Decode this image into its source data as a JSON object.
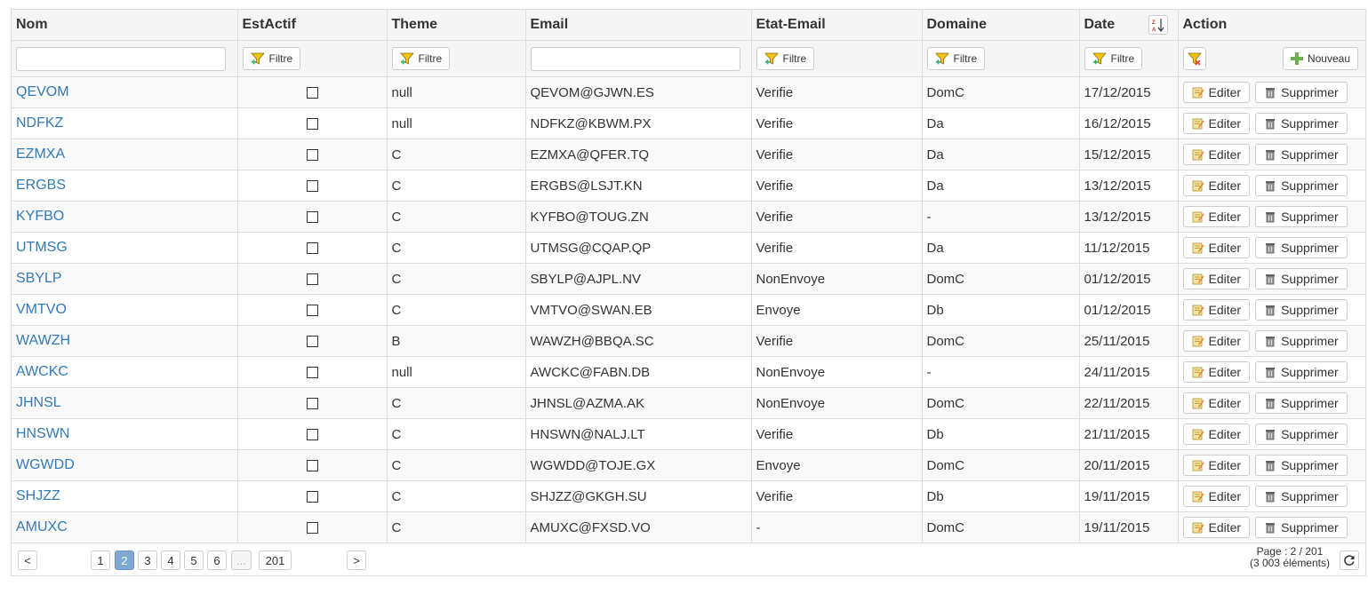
{
  "columns": {
    "nom": "Nom",
    "est_actif": "EstActif",
    "theme": "Theme",
    "email": "Email",
    "etat_email": "Etat-Email",
    "domaine": "Domaine",
    "date": "Date",
    "action": "Action"
  },
  "filters": {
    "nom_value": "",
    "email_value": "",
    "filter_label": "Filtre",
    "new_label": "Nouveau"
  },
  "actions": {
    "edit_label": "Editer",
    "delete_label": "Supprimer"
  },
  "colors": {
    "link": "#337ab7",
    "active_page": "#7fa9d3"
  },
  "rows": [
    {
      "nom": "QEVOM",
      "est_actif": false,
      "theme": "null",
      "email": "QEVOM@GJWN.ES",
      "etat": "Verifie",
      "domaine": "DomC",
      "date": "17/12/2015"
    },
    {
      "nom": "NDFKZ",
      "est_actif": false,
      "theme": "null",
      "email": "NDFKZ@KBWM.PX",
      "etat": "Verifie",
      "domaine": "Da",
      "date": "16/12/2015"
    },
    {
      "nom": "EZMXA",
      "est_actif": false,
      "theme": "C",
      "email": "EZMXA@QFER.TQ",
      "etat": "Verifie",
      "domaine": "Da",
      "date": "15/12/2015"
    },
    {
      "nom": "ERGBS",
      "est_actif": false,
      "theme": "C",
      "email": "ERGBS@LSJT.KN",
      "etat": "Verifie",
      "domaine": "Da",
      "date": "13/12/2015"
    },
    {
      "nom": "KYFBO",
      "est_actif": false,
      "theme": "C",
      "email": "KYFBO@TOUG.ZN",
      "etat": "Verifie",
      "domaine": "-",
      "date": "13/12/2015"
    },
    {
      "nom": "UTMSG",
      "est_actif": false,
      "theme": "C",
      "email": "UTMSG@CQAP.QP",
      "etat": "Verifie",
      "domaine": "Da",
      "date": "11/12/2015"
    },
    {
      "nom": "SBYLP",
      "est_actif": false,
      "theme": "C",
      "email": "SBYLP@AJPL.NV",
      "etat": "NonEnvoye",
      "domaine": "DomC",
      "date": "01/12/2015"
    },
    {
      "nom": "VMTVO",
      "est_actif": false,
      "theme": "C",
      "email": "VMTVO@SWAN.EB",
      "etat": "Envoye",
      "domaine": "Db",
      "date": "01/12/2015"
    },
    {
      "nom": "WAWZH",
      "est_actif": false,
      "theme": "B",
      "email": "WAWZH@BBQA.SC",
      "etat": "Verifie",
      "domaine": "DomC",
      "date": "25/11/2015"
    },
    {
      "nom": "AWCKC",
      "est_actif": false,
      "theme": "null",
      "email": "AWCKC@FABN.DB",
      "etat": "NonEnvoye",
      "domaine": "-",
      "date": "24/11/2015"
    },
    {
      "nom": "JHNSL",
      "est_actif": false,
      "theme": "C",
      "email": "JHNSL@AZMA.AK",
      "etat": "NonEnvoye",
      "domaine": "DomC",
      "date": "22/11/2015"
    },
    {
      "nom": "HNSWN",
      "est_actif": false,
      "theme": "C",
      "email": "HNSWN@NALJ.LT",
      "etat": "Verifie",
      "domaine": "Db",
      "date": "21/11/2015"
    },
    {
      "nom": "WGWDD",
      "est_actif": false,
      "theme": "C",
      "email": "WGWDD@TOJE.GX",
      "etat": "Envoye",
      "domaine": "DomC",
      "date": "20/11/2015"
    },
    {
      "nom": "SHJZZ",
      "est_actif": false,
      "theme": "C",
      "email": "SHJZZ@GKGH.SU",
      "etat": "Verifie",
      "domaine": "Db",
      "date": "19/11/2015"
    },
    {
      "nom": "AMUXC",
      "est_actif": false,
      "theme": "C",
      "email": "AMUXC@FXSD.VO",
      "etat": "-",
      "domaine": "DomC",
      "date": "19/11/2015"
    }
  ],
  "pager": {
    "prev": "<",
    "next": ">",
    "pages": [
      "1",
      "2",
      "3",
      "4",
      "5",
      "6"
    ],
    "active_page": "2",
    "ellipsis": "...",
    "last_page": "201",
    "page_info": "Page : 2 / 201",
    "count_info": "(3 003 éléments)"
  }
}
